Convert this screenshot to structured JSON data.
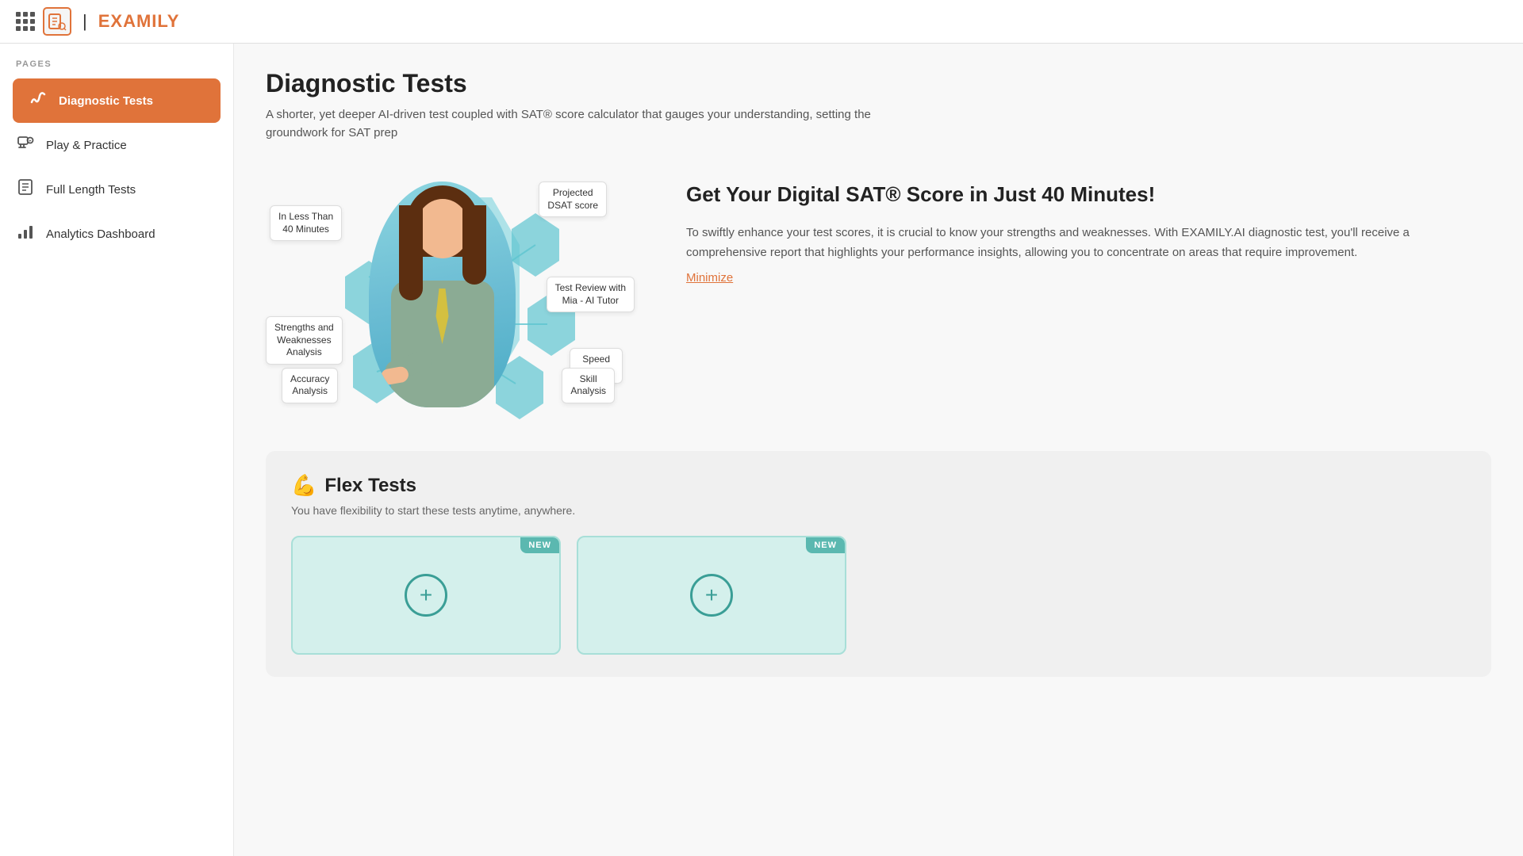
{
  "header": {
    "grid_icon": "grid-icon",
    "logo_text": "EXAMILY",
    "logo_separator": "|"
  },
  "sidebar": {
    "section_label": "PAGES",
    "items": [
      {
        "id": "diagnostic-tests",
        "label": "Diagnostic Tests",
        "icon": "📊",
        "active": true
      },
      {
        "id": "play-practice",
        "label": "Play & Practice",
        "icon": "🎮",
        "active": false
      },
      {
        "id": "full-length-tests",
        "label": "Full Length Tests",
        "icon": "📋",
        "active": false
      },
      {
        "id": "analytics-dashboard",
        "label": "Analytics Dashboard",
        "icon": "📈",
        "active": false
      }
    ]
  },
  "main": {
    "page_title": "Diagnostic Tests",
    "page_subtitle": "A shorter, yet deeper AI-driven test coupled with SAT® score calculator that gauges your understanding, setting the groundwork for SAT prep",
    "hero": {
      "title": "Get Your Digital SAT® Score in Just 40 Minutes!",
      "body": "To swiftly enhance your test scores, it is crucial to know your strengths and weaknesses. With EXAMILY.AI diagnostic test, you'll receive a comprehensive report that highlights your performance insights, allowing you to concentrate on areas that require improvement.",
      "minimize_label": "Minimize",
      "diagram_labels": [
        {
          "id": "less-than-40",
          "text": "In Less Than\n40 Minutes"
        },
        {
          "id": "projected-dsat",
          "text": "Projected\nDSAT score"
        },
        {
          "id": "test-review",
          "text": "Test Review with\nMia - AI Tutor"
        },
        {
          "id": "speed-analysis",
          "text": "Speed\nAnalysis"
        },
        {
          "id": "skill-analysis",
          "text": "Skill\nAnalysis"
        },
        {
          "id": "accuracy-analysis",
          "text": "Accuracy\nAnalysis"
        },
        {
          "id": "strengths-weaknesses",
          "text": "Strengths and\nWeaknesses\nAnalysis"
        }
      ]
    },
    "flex_tests": {
      "emoji": "💪",
      "title": "Flex Tests",
      "subtitle": "You have flexibility to start these tests anytime, anywhere.",
      "cards": [
        {
          "id": "card-1",
          "badge": "NEW",
          "has_add": true
        },
        {
          "id": "card-2",
          "badge": "NEW",
          "has_add": true
        }
      ]
    }
  }
}
